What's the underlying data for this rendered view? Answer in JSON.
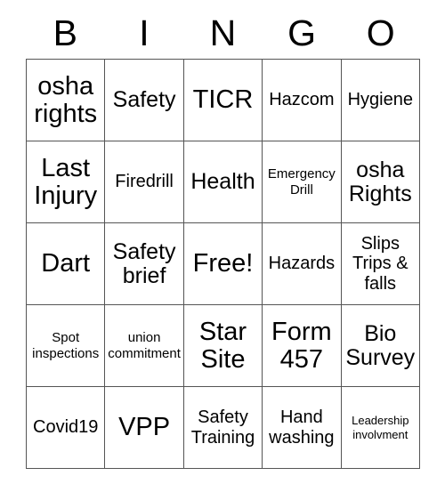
{
  "card": {
    "title_letters": [
      "B",
      "I",
      "N",
      "G",
      "O"
    ],
    "columns": 5,
    "rows": 5,
    "free_space_label": "Free!",
    "border_color": "#555555",
    "text_color": "#000000",
    "background_color": "#ffffff",
    "cells": [
      [
        {
          "text": "osha rights",
          "size": "xl"
        },
        {
          "text": "Safety",
          "size": "lg"
        },
        {
          "text": "TICR",
          "size": "xl"
        },
        {
          "text": "Hazcom",
          "size": "md"
        },
        {
          "text": "Hygiene",
          "size": "md"
        }
      ],
      [
        {
          "text": "Last Injury",
          "size": "xl"
        },
        {
          "text": "Firedrill",
          "size": "md"
        },
        {
          "text": "Health",
          "size": "lg"
        },
        {
          "text": "Emergency Drill",
          "size": "sm"
        },
        {
          "text": "osha Rights",
          "size": "lg"
        }
      ],
      [
        {
          "text": "Dart",
          "size": "xl"
        },
        {
          "text": "Safety brief",
          "size": "lg"
        },
        {
          "text": "Free!",
          "size": "xl"
        },
        {
          "text": "Hazards",
          "size": "md"
        },
        {
          "text": "Slips Trips & falls",
          "size": "md"
        }
      ],
      [
        {
          "text": "Spot inspections",
          "size": "sm"
        },
        {
          "text": "union commitment",
          "size": "sm"
        },
        {
          "text": "Star Site",
          "size": "xl"
        },
        {
          "text": "Form 457",
          "size": "xl"
        },
        {
          "text": "Bio Survey",
          "size": "lg"
        }
      ],
      [
        {
          "text": "Covid19",
          "size": "md"
        },
        {
          "text": "VPP",
          "size": "xl"
        },
        {
          "text": "Safety Training",
          "size": "md"
        },
        {
          "text": "Hand washing",
          "size": "md"
        },
        {
          "text": "Leadership involvment",
          "size": "xs"
        }
      ]
    ]
  }
}
